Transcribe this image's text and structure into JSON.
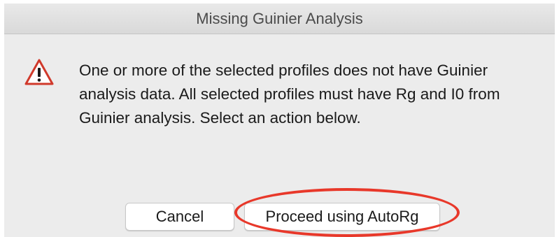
{
  "dialog": {
    "title": "Missing Guinier Analysis",
    "icon": "warning-triangle-icon",
    "message": "One or more of the selected profiles does not have Guinier analysis data. All selected profiles must have Rg and I0 from Guinier analysis. Select an action below.",
    "buttons": {
      "cancel_label": "Cancel",
      "proceed_label": "Proceed using AutoRg"
    }
  },
  "annotation": {
    "highlight_color": "#e8382a",
    "highlighted_element": "proceed-autorg-button"
  },
  "colors": {
    "warning_icon": "#d0392b",
    "dialog_background": "#ececec"
  }
}
